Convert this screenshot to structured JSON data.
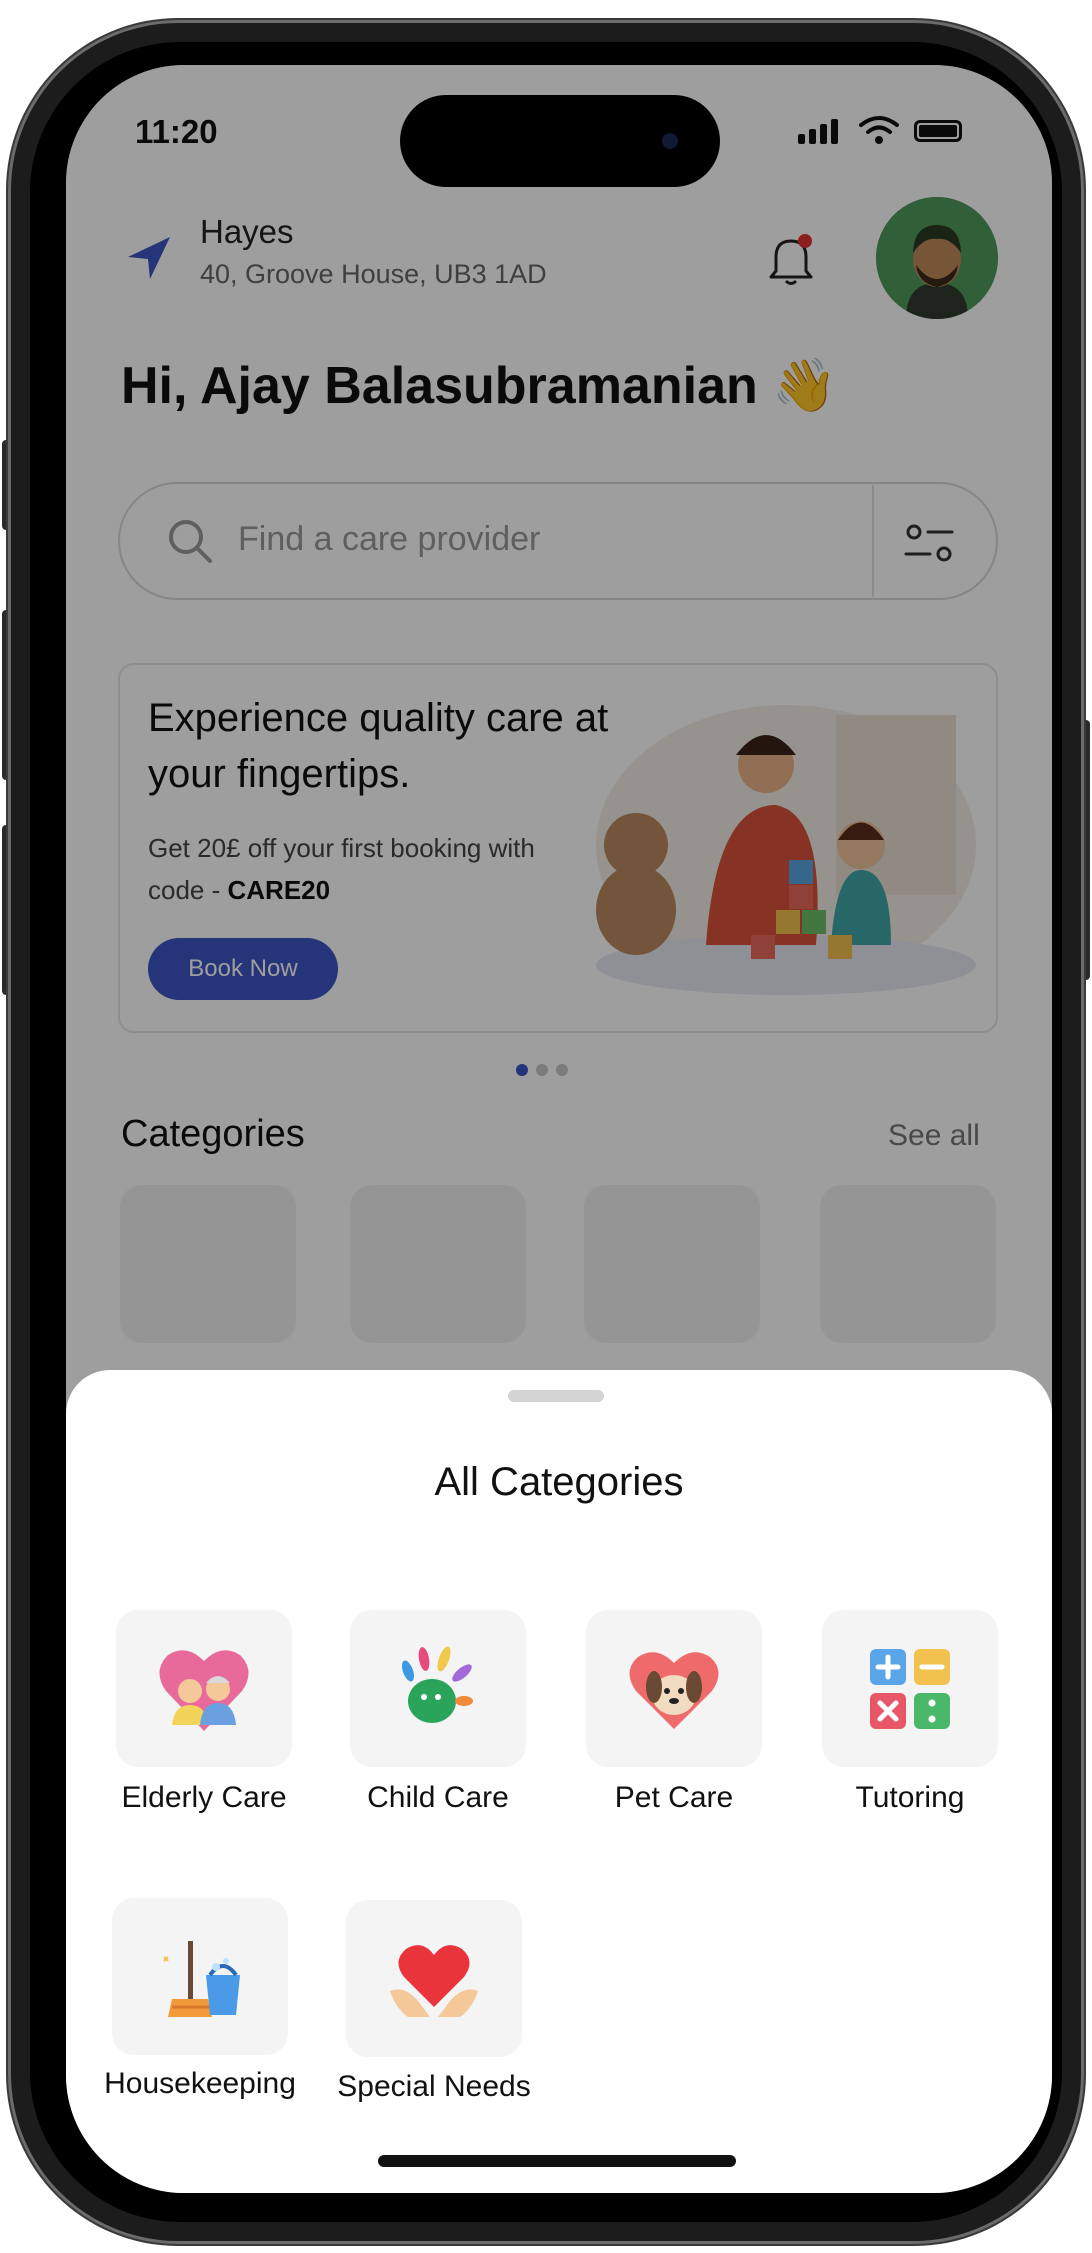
{
  "status_bar": {
    "time": "11:20"
  },
  "header": {
    "location_city": "Hayes",
    "location_address": "40, Groove House, UB3 1AD"
  },
  "greeting": "Hi, Ajay Balasubramanian 👋",
  "search": {
    "placeholder": "Find a care provider"
  },
  "promo": {
    "title": "Experience quality care at your fingertips.",
    "subtitle_prefix": "Get 20£ off your first booking with code - ",
    "code": "CARE20",
    "button_label": "Book Now",
    "carousel_pages": 3,
    "carousel_active": 1
  },
  "categories_section": {
    "heading": "Categories",
    "see_all_label": "See all"
  },
  "sheet": {
    "title": "All Categories",
    "items": [
      {
        "label": "Elderly Care",
        "icon": "elderly-care-icon"
      },
      {
        "label": "Child Care",
        "icon": "child-care-icon"
      },
      {
        "label": "Pet Care",
        "icon": "pet-care-icon"
      },
      {
        "label": "Tutoring",
        "icon": "tutoring-icon"
      },
      {
        "label": "Housekeeping",
        "icon": "housekeeping-icon"
      },
      {
        "label": "Special Needs",
        "icon": "special-needs-icon"
      }
    ]
  },
  "colors": {
    "accent": "#3e54c6",
    "overlay": "rgba(0,0,0,0.38)",
    "tile_bg": "#f4f4f4"
  }
}
